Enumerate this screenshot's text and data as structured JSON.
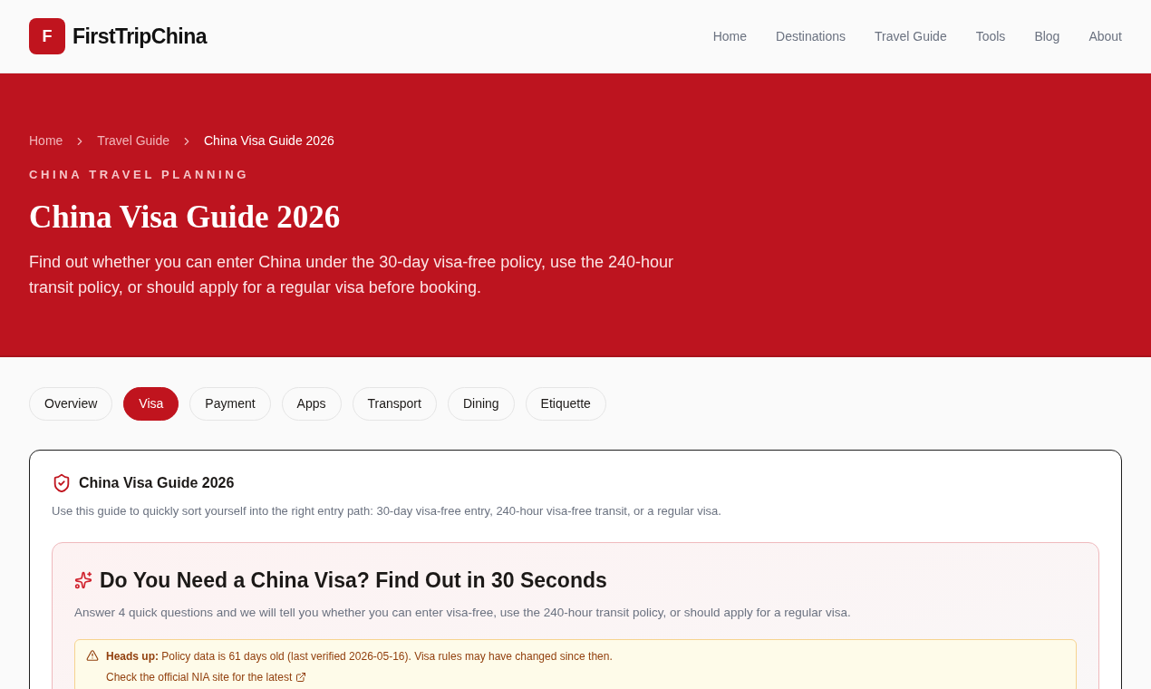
{
  "header": {
    "logo_letter": "F",
    "brand": "FirstTripChina",
    "nav": [
      "Home",
      "Destinations",
      "Travel Guide",
      "Tools",
      "Blog",
      "About"
    ]
  },
  "hero": {
    "breadcrumb": [
      {
        "label": "Home",
        "current": false
      },
      {
        "label": "Travel Guide",
        "current": false
      },
      {
        "label": "China Visa Guide 2026",
        "current": true
      }
    ],
    "eyebrow": "CHINA TRAVEL PLANNING",
    "title": "China Visa Guide 2026",
    "description": "Find out whether you can enter China under the 30-day visa-free policy, use the 240-hour transit policy, or should apply for a regular visa before booking."
  },
  "tabs": [
    {
      "label": "Overview",
      "selected": false
    },
    {
      "label": "Visa",
      "selected": true
    },
    {
      "label": "Payment",
      "selected": false
    },
    {
      "label": "Apps",
      "selected": false
    },
    {
      "label": "Transport",
      "selected": false
    },
    {
      "label": "Dining",
      "selected": false
    },
    {
      "label": "Etiquette",
      "selected": false
    }
  ],
  "guide_card": {
    "title": "China Visa Guide 2026",
    "description": "Use this guide to quickly sort yourself into the right entry path: 30-day visa-free entry, 240-hour visa-free transit, or a regular visa."
  },
  "quiz": {
    "title": "Do You Need a China Visa? Find Out in 30 Seconds",
    "description": "Answer 4 quick questions and we will tell you whether you can enter visa-free, use the 240-hour transit policy, or should apply for a regular visa.",
    "alert": {
      "text": "**Heads up:** Policy data is 61 days old (last verified 2026-05-16). Visa rules may have changed since then.",
      "link": "Check the official NIA site for the latest"
    }
  }
}
